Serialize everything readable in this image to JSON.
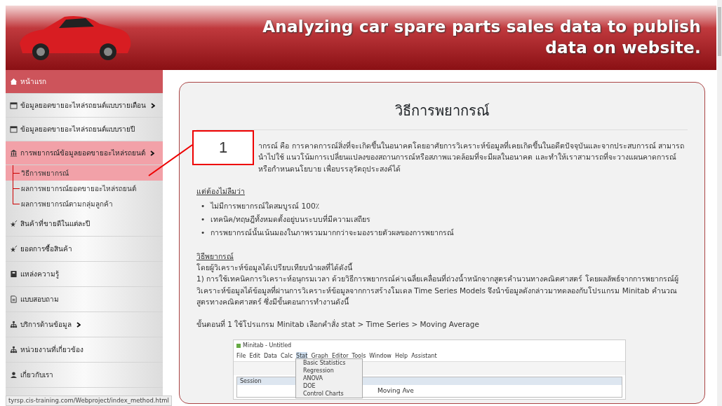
{
  "header": {
    "title_lines": [
      "Analyzing car spare parts sales data to publish",
      "data on website."
    ]
  },
  "sidebar": {
    "items": [
      {
        "label": "หน้าแรก",
        "kind": "home",
        "selected": false,
        "has_submenu": false
      },
      {
        "label": "ข้อมูลยอดขายอะไหล่รถยนต์แบบรายเดือน",
        "kind": "item",
        "selected": false,
        "has_submenu": true
      },
      {
        "label": "ข้อมูลยอดขายอะไหล่รถยนต์แบบรายปี",
        "kind": "item",
        "selected": false,
        "has_submenu": false
      },
      {
        "label": "การพยากรณ์ข้อมูลยอดขายอะไหล่รถยนต์",
        "kind": "item",
        "selected": true,
        "has_submenu": true,
        "children": [
          {
            "label": "วิธีการพยากรณ์",
            "selected": true
          },
          {
            "label": "ผลการพยากรณ์ยอดขายอะไหล่รถยนต์",
            "selected": false
          },
          {
            "label": "ผลการพยากรณ์ตามกลุ่มลูกค้า",
            "selected": false
          }
        ]
      },
      {
        "label": "สินค้าที่ขายดีในแต่ละปี",
        "kind": "item",
        "selected": false,
        "has_submenu": false
      },
      {
        "label": "ยอดการซื้อสินค้า",
        "kind": "item",
        "selected": false,
        "has_submenu": false
      },
      {
        "label": "แหล่งความรู้",
        "kind": "item",
        "selected": false,
        "has_submenu": false
      },
      {
        "label": "แบบสอบถาม",
        "kind": "item",
        "selected": false,
        "has_submenu": false
      },
      {
        "label": "บริการด้านข้อมูล",
        "kind": "item",
        "selected": false,
        "has_submenu": true
      },
      {
        "label": "หน่วยงานที่เกี่ยวข้อง",
        "kind": "item",
        "selected": false,
        "has_submenu": false
      },
      {
        "label": "เกี่ยวกับเรา",
        "kind": "item",
        "selected": false,
        "has_submenu": false
      }
    ]
  },
  "content": {
    "title": "วิธีการพยากรณ์",
    "intro": "ากรณ์ คือ การคาดการณ์สิ่งที่จะเกิดขึ้นในอนาคตโดยอาศัยการวิเคราะห์ข้อมูลที่เคยเกิดขึ้นในอดีตปัจจุบันและจากประสบการณ์ สามารถนำไปใช้ แนวโน้มการเปลี่ยนแปลงของสถานการณ์หรือสภาพแวดล้อมที่จะมีผลในอนาคต และทำให้เราสามารถที่จะวางแผนคาดการณ์ หรือกำหนดนโยบาย เพื่อบรรลุวัตถุประสงค์ได้",
    "note_heading": "แต่ต้องไม่ลืมว่า",
    "bullets": [
      {
        "marker": "•",
        "text": "ไม่มีการพยากรณ์ใดสมบูรณ์ 100٪"
      },
      {
        "marker": "•",
        "text": "เทคนิค/ทฤษฎีทั้งหมดตั้งอยู่บนระบบที่มีความเสถียร"
      },
      {
        "marker": "•",
        "text": "การพยากรณ์นั้นเน้นมองในภาพรวมมากกว่าจะมองรายตัวผลของการพยากรณ์"
      }
    ],
    "method_heading": "วิธีพยากรณ์",
    "method_lead": "โดยผู้วิเคราะห์ข้อมูลได้เปรียบเทียบนำผลที่ได้ดังนี้",
    "method_text": "1) การใช้เทคนิคการวิเคราะห์อนุกรมเวลา ด้วยวิธีการพยากรณ์ค่าเฉลี่ยเคลื่อนที่ถ่วงน้ำหนักจากสูตรคำนวนทางคณิตศาสตร์ โดยผลลัพธ์จากการพยากรณ์ผู้วิเคราะห์ข้อมูลได้ข้อมูลที่ผ่านการวิเคราะห์ข้อมูลจากการสร้างโมเดล Time Series Models จึงนำข้อมูลดังกล่าวมาทดลองกับโปรแกรม Minitab คำนวณสูตรทางคณิตศาสตร์ ซึ่งมีขั้นตอนการทำงานดังนี้",
    "step": "ขั้นตอนที่ 1 ใช้โปรแกรม Minitab เลือกคำสั่ง stat > Time Series > Moving Average",
    "app_window": {
      "title": "Minitab - Untitled",
      "menu": [
        {
          "label": "File",
          "selected": false
        },
        {
          "label": "Edit",
          "selected": false
        },
        {
          "label": "Data",
          "selected": false
        },
        {
          "label": "Calc",
          "selected": false
        },
        {
          "label": "Stat",
          "selected": true
        },
        {
          "label": "Graph",
          "selected": false
        },
        {
          "label": "Editor",
          "selected": false
        },
        {
          "label": "Tools",
          "selected": false
        },
        {
          "label": "Window",
          "selected": false
        },
        {
          "label": "Help",
          "selected": false
        },
        {
          "label": "Assistant",
          "selected": false
        }
      ],
      "dropdown": [
        "Basic Statistics",
        "Regression",
        "ANOVA",
        "DOE",
        "Control Charts"
      ],
      "session_title": "Session",
      "session_text": "Moving Ave"
    }
  },
  "callout": {
    "label": "1"
  },
  "status_url": "tyrsp.cis-training.com/Webproject/index_method.html"
}
